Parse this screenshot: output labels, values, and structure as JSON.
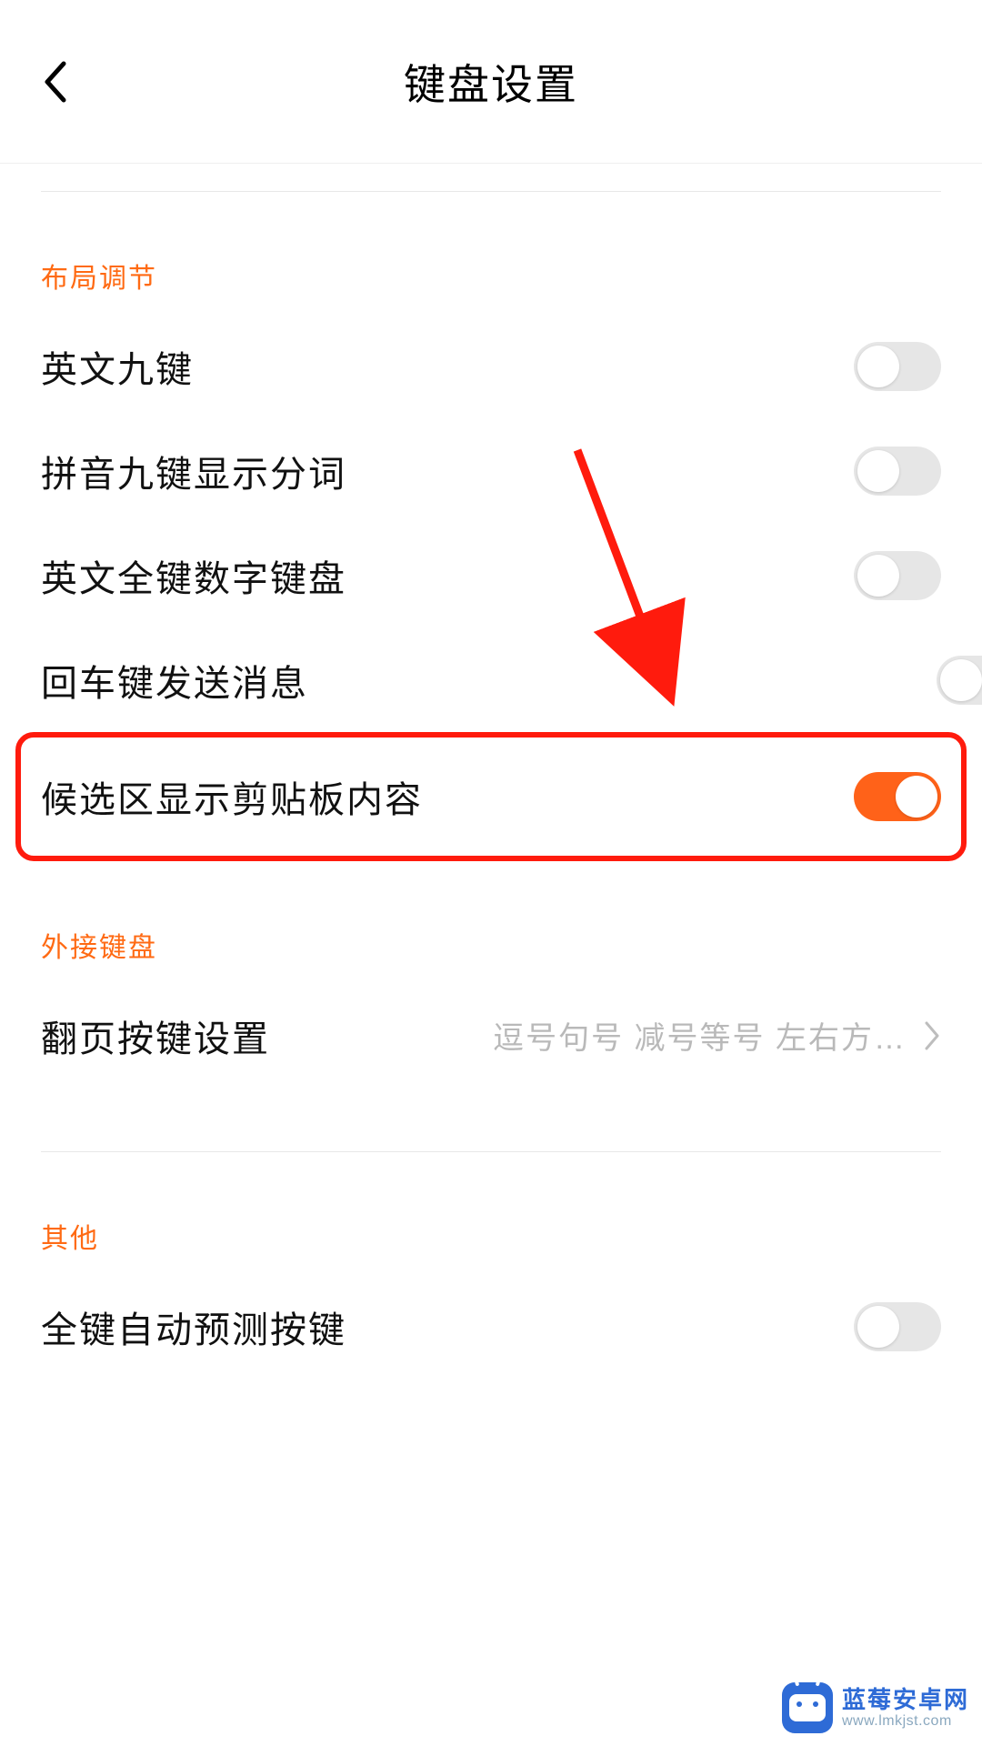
{
  "header": {
    "title": "键盘设置"
  },
  "sections": {
    "layout": {
      "header": "布局调节",
      "items": [
        {
          "label": "英文九键",
          "on": false
        },
        {
          "label": "拼音九键显示分词",
          "on": false
        },
        {
          "label": "英文全键数字键盘",
          "on": false
        },
        {
          "label": "回车键发送消息",
          "on": false
        },
        {
          "label": "候选区显示剪贴板内容",
          "on": true
        }
      ]
    },
    "external": {
      "header": "外接键盘",
      "page_keys": {
        "label": "翻页按键设置",
        "value": "逗号句号 减号等号 左右方…"
      }
    },
    "other": {
      "header": "其他",
      "items": [
        {
          "label": "全键自动预测按键",
          "on": false
        }
      ]
    }
  },
  "watermark": {
    "name": "蓝莓安卓网",
    "url": "www.lmkjst.com"
  },
  "colors": {
    "accent": "#ff6a13",
    "toggle_on": "#ff6219",
    "highlight_border": "#ff1b0d"
  }
}
